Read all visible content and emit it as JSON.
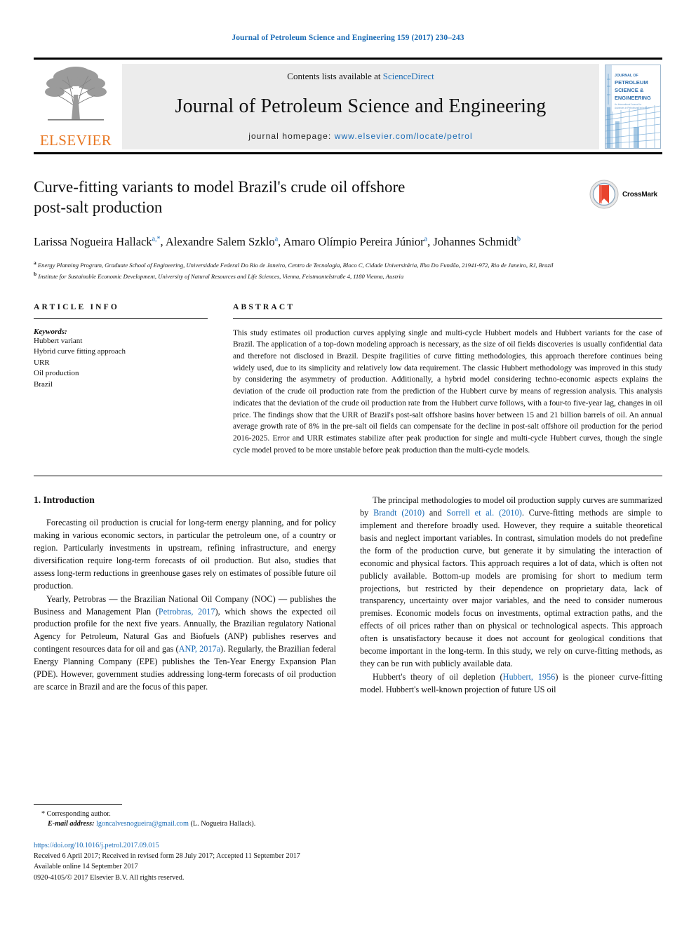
{
  "running_head": "Journal of Petroleum Science and Engineering 159 (2017) 230–243",
  "masthead": {
    "contents_prefix": "Contents lists available at ",
    "contents_link": "ScienceDirect",
    "journal_title": "Journal of Petroleum Science and Engineering",
    "homepage_prefix": "journal homepage: ",
    "homepage_link": "www.elsevier.com/locate/petrol",
    "publisher": "ELSEVIER",
    "cover_lines": [
      "JOURNAL OF",
      "PETROLEUM",
      "SCIENCE &",
      "ENGINEERING"
    ],
    "cover_sub": "An International Journal for Advances in Petroleum Exploration"
  },
  "article": {
    "title_line1": "Curve-fitting variants to model Brazil's crude oil offshore",
    "title_line2": "post-salt production",
    "crossmark_label": "CrossMark",
    "authors_html": "Larissa Nogueira Hallack<sup>a,*</sup>, Alexandre Salem Szklo<sup>a</sup>, Amaro Olímpio Pereira Júnior<sup>a</sup>, Johannes Schmidt<sup>b</sup>",
    "affiliation_a": "Energy Planning Program, Graduate School of Engineering, Universidade Federal Do Rio de Janeiro, Centro de Tecnologia, Bloco C, Cidade Universitária, Ilha Do Fundão, 21941-972, Rio de Janeiro, RJ, Brazil",
    "affiliation_b": "Institute for Sustainable Economic Development, University of Natural Resources and Life Sciences, Vienna, Feistmantelstraße 4, 1180 Vienna, Austria",
    "affil_a_marker": "a",
    "affil_b_marker": "b"
  },
  "article_info": {
    "heading": "ARTICLE INFO",
    "keywords_label": "Keywords:",
    "keywords": [
      "Hubbert variant",
      "Hybrid curve fitting approach",
      "URR",
      "Oil production",
      "Brazil"
    ]
  },
  "abstract": {
    "heading": "ABSTRACT",
    "text": "This study estimates oil production curves applying single and multi-cycle Hubbert models and Hubbert variants for the case of Brazil. The application of a top-down modeling approach is necessary, as the size of oil fields discoveries is usually confidential data and therefore not disclosed in Brazil. Despite fragilities of curve fitting methodologies, this approach therefore continues being widely used, due to its simplicity and relatively low data requirement. The classic Hubbert methodology was improved in this study by considering the asymmetry of production. Additionally, a hybrid model considering techno-economic aspects explains the deviation of the crude oil production rate from the prediction of the Hubbert curve by means of regression analysis. This analysis indicates that the deviation of the crude oil production rate from the Hubbert curve follows, with a four-to five-year lag, changes in oil price. The findings show that the URR of Brazil's post-salt offshore basins hover between 15 and 21 billion barrels of oil. An annual average growth rate of 8% in the pre-salt oil fields can compensate for the decline in post-salt offshore oil production for the period 2016-2025. Error and URR estimates stabilize after peak production for single and multi-cycle Hubbert curves, though the single cycle model proved to be more unstable before peak production than the multi-cycle models."
  },
  "introduction": {
    "section_title": "1. Introduction",
    "left_paragraphs": [
      "Forecasting oil production is crucial for long-term energy planning, and for policy making in various economic sectors, in particular the petroleum one, of a country or region. Particularly investments in upstream, refining infrastructure, and energy diversification require long-term forecasts of oil production. But also, studies that assess long-term reductions in greenhouse gases rely on estimates of possible future oil production."
    ],
    "left_para2_parts": {
      "a": "Yearly, Petrobras — the Brazilian National Oil Company (NOC) — publishes the Business and Management Plan (",
      "ref1": "Petrobras, 2017",
      "b": "), which shows the expected oil production profile for the next five years. Annually, the Brazilian regulatory National Agency for Petroleum, Natural Gas and Biofuels (ANP) publishes reserves and contingent resources data for oil and gas (",
      "ref2": "ANP, 2017a",
      "c": "). Regularly, the Brazilian federal Energy Planning Company (EPE) publishes the Ten-Year Energy Expansion Plan (PDE). However, government studies addressing long-term forecasts of oil production are scarce in Brazil and are the focus of this paper."
    },
    "right_para1_parts": {
      "a": "The principal methodologies to model oil production supply curves are summarized by ",
      "ref1": "Brandt (2010)",
      "b": " and ",
      "ref2": "Sorrell et al. (2010)",
      "c": ". Curve-fitting methods are simple to implement and therefore broadly used. However, they require a suitable theoretical basis and neglect important variables. In contrast, simulation models do not predefine the form of the production curve, but generate it by simulating the interaction of economic and physical factors. This approach requires a lot of data, which is often not publicly available. Bottom-up models are promising for short to medium term projections, but restricted by their dependence on proprietary data, lack of transparency, uncertainty over major variables, and the need to consider numerous premises. Economic models focus on investments, optimal extraction paths, and the effects of oil prices rather than on physical or technological aspects. This approach often is unsatisfactory because it does not account for geological conditions that become important in the long-term. In this study, we rely on curve-fitting methods, as they can be run with publicly available data."
    },
    "right_para2_parts": {
      "a": "Hubbert's theory of oil depletion (",
      "ref1": "Hubbert, 1956",
      "b": ") is the pioneer curve-fitting model. Hubbert's well-known projection of future US oil"
    }
  },
  "footer": {
    "corresponding_marker": "*",
    "corresponding_text": "Corresponding author.",
    "email_label": "E-mail address:",
    "email": "lgoncalvesnogueira@gmail.com",
    "email_suffix": "(L. Nogueira Hallack).",
    "doi": "https://doi.org/10.1016/j.petrol.2017.09.015",
    "received": "Received 6 April 2017; Received in revised form 28 July 2017; Accepted 11 September 2017",
    "available": "Available online 14 September 2017",
    "copyright": "0920-4105/© 2017 Elsevier B.V. All rights reserved."
  },
  "colors": {
    "link_blue": "#1a6bb5",
    "elsevier_orange": "#E87722",
    "crossmark_red": "#E8442E",
    "band_gray": "#ececec"
  }
}
